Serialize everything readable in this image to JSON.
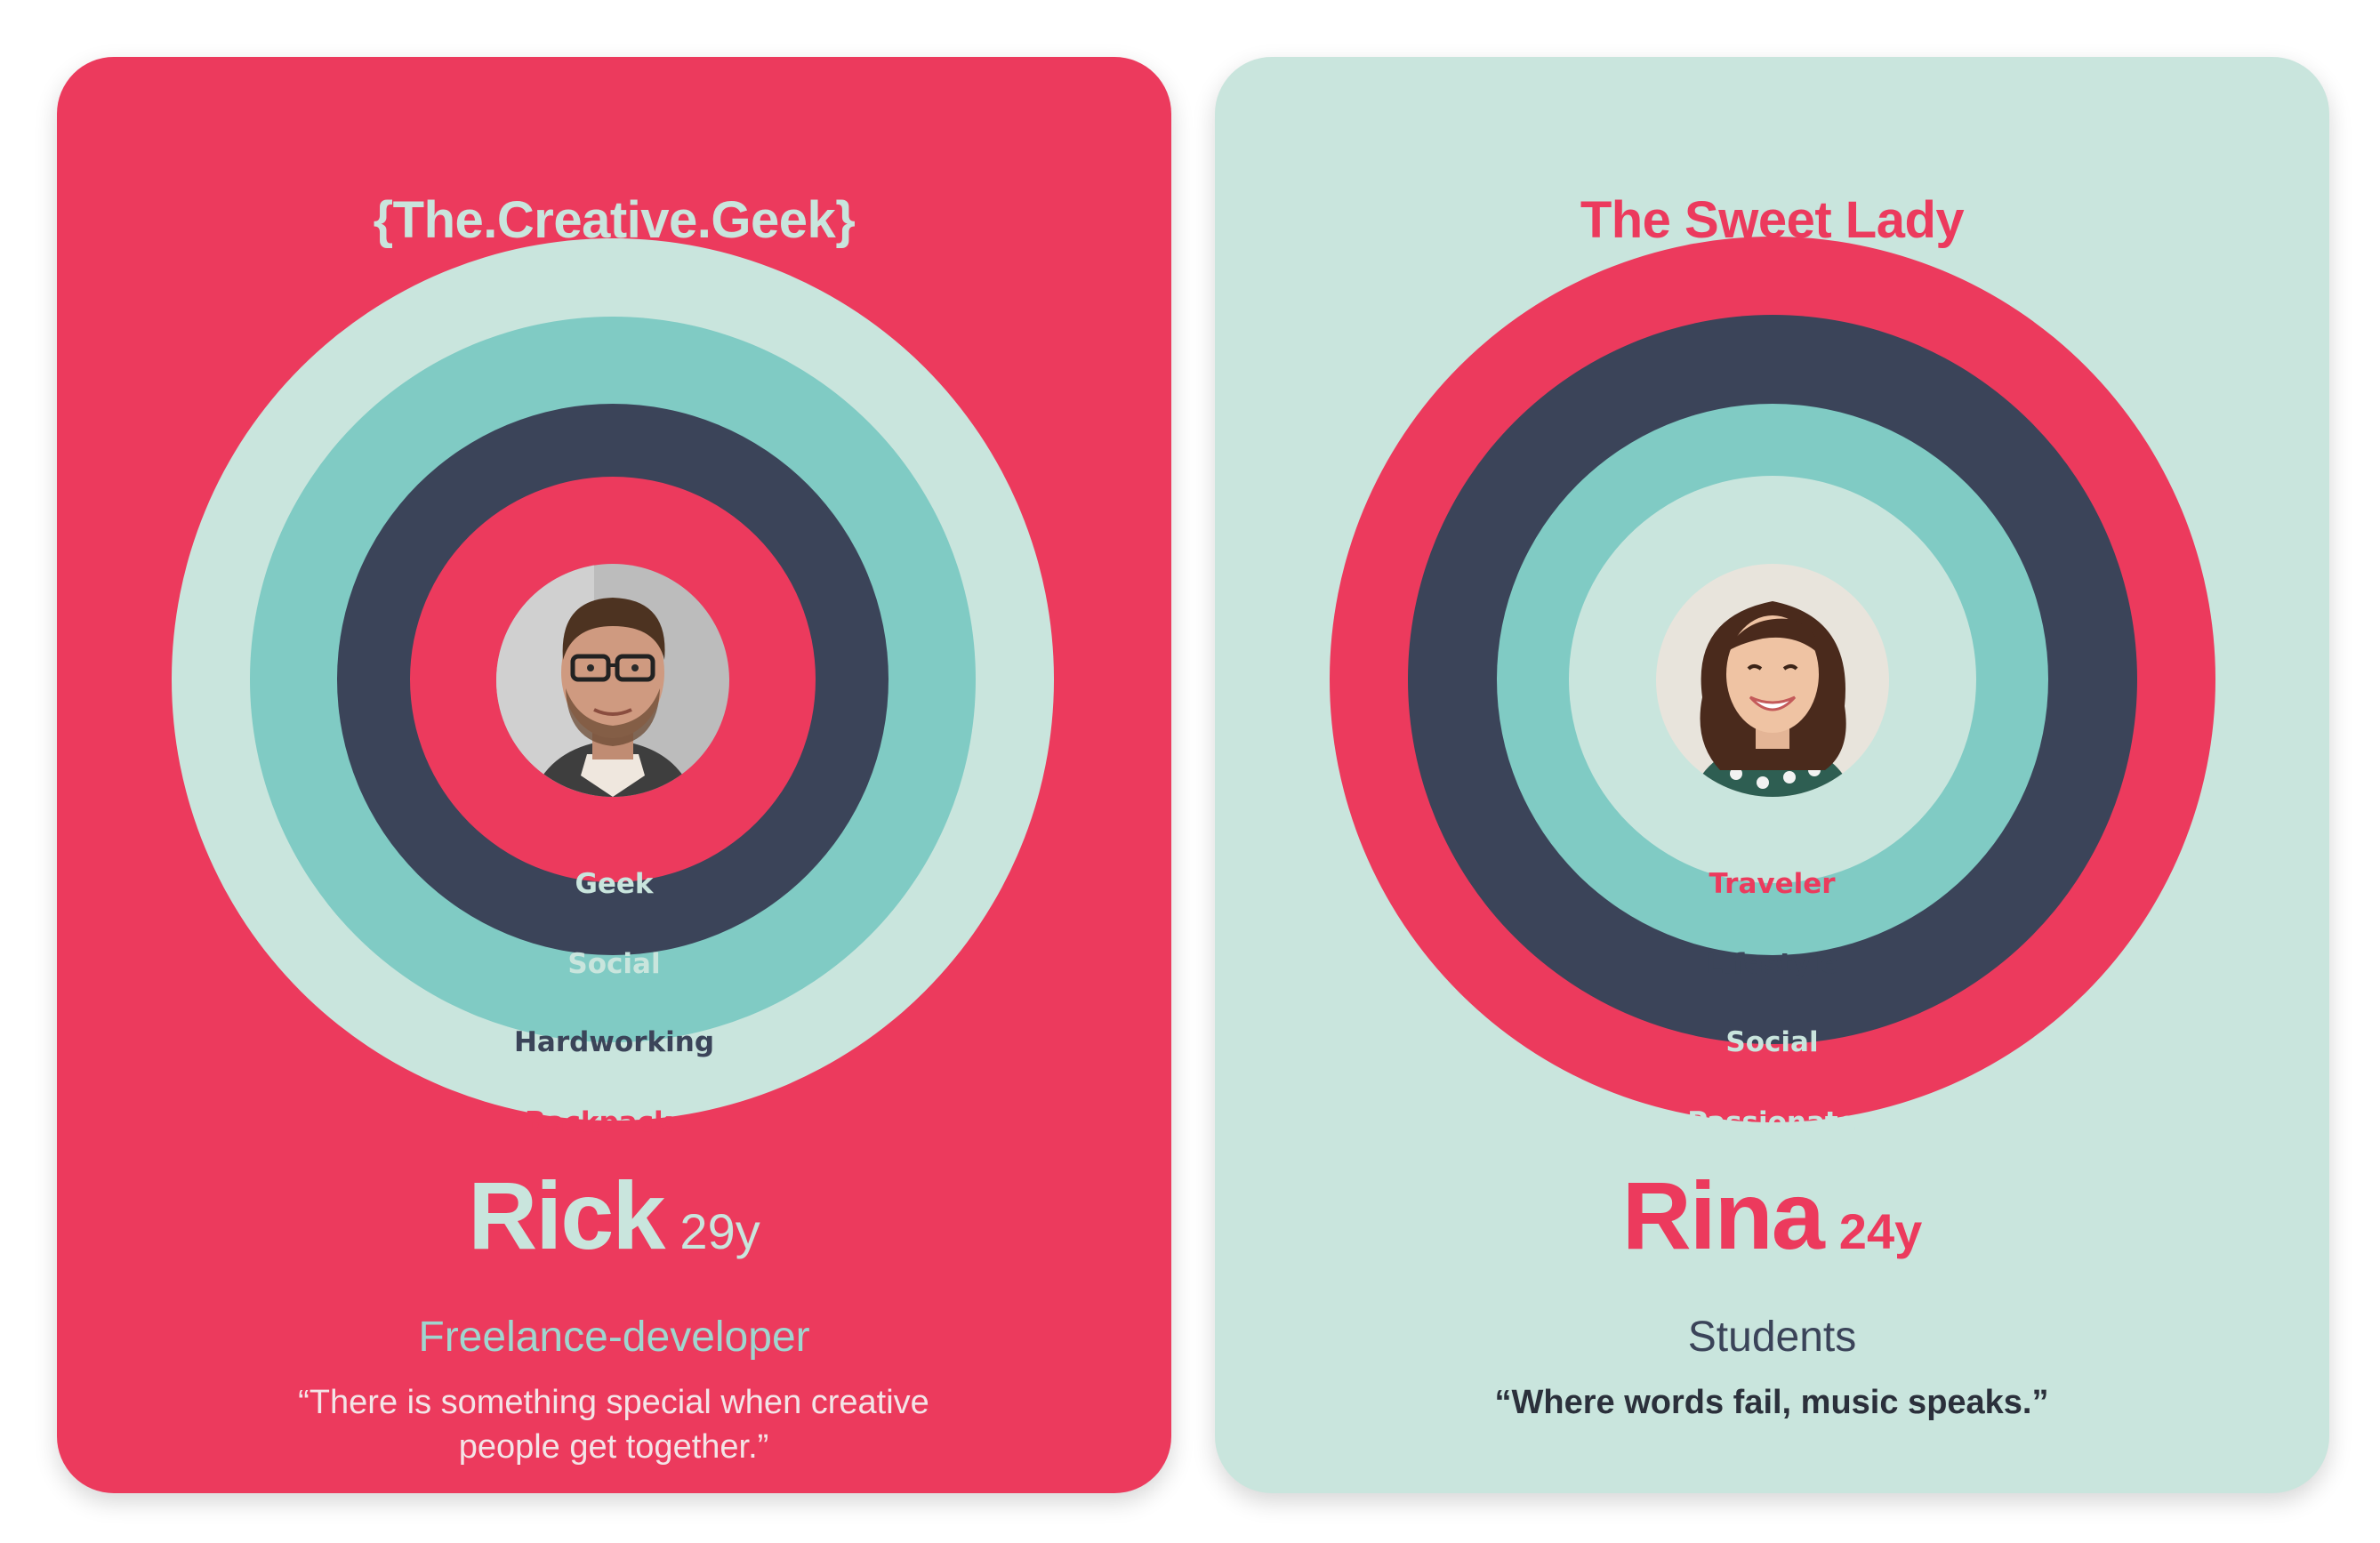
{
  "cards": [
    {
      "title": "{The.Creative.Geek}",
      "ring_labels": [
        "Geek",
        "Social",
        "Hardworking",
        "Backpacker"
      ],
      "name": "Rick",
      "age": "29y",
      "occupation": "Freelance-developer",
      "quote": "“There is something special when creative people get together.”",
      "colors": {
        "background": "#ec3a5d",
        "title": "#c9e5dd",
        "rings_outer_to_inner": [
          "#c9e5dd",
          "#80cbc4",
          "#3b4459",
          "#ec3a5d"
        ],
        "ring_label_colors": [
          "#c9e5dd",
          "#c9e5dd",
          "#3b4459",
          "#ec3a5d"
        ],
        "name": "#c9e5dd",
        "age": "#c9e5dd",
        "occupation": "#9fd6cf",
        "quote": "#f3e4e7"
      },
      "avatar_icon": "man-with-glasses-avatar-icon"
    },
    {
      "title": "The Sweet Lady",
      "ring_labels": [
        "Traveler",
        "Lifestyle",
        "Social",
        "Passionate"
      ],
      "name": "Rina",
      "age": "24y",
      "occupation": "Students",
      "quote": "“Where words fail, music speaks.”",
      "colors": {
        "background": "#c9e5dd",
        "title": "#ec3a5d",
        "rings_outer_to_inner": [
          "#ec3a5d",
          "#3b4459",
          "#80cbc4",
          "#c9e5dd"
        ],
        "ring_label_colors": [
          "#ec3a5d",
          "#3b4459",
          "#c9e5dd",
          "#c9e5dd"
        ],
        "name": "#ec3a5d",
        "age": "#ec3a5d",
        "occupation": "#3b4459",
        "quote": "#2b303b"
      },
      "avatar_icon": "curly-haired-woman-avatar-icon"
    }
  ]
}
